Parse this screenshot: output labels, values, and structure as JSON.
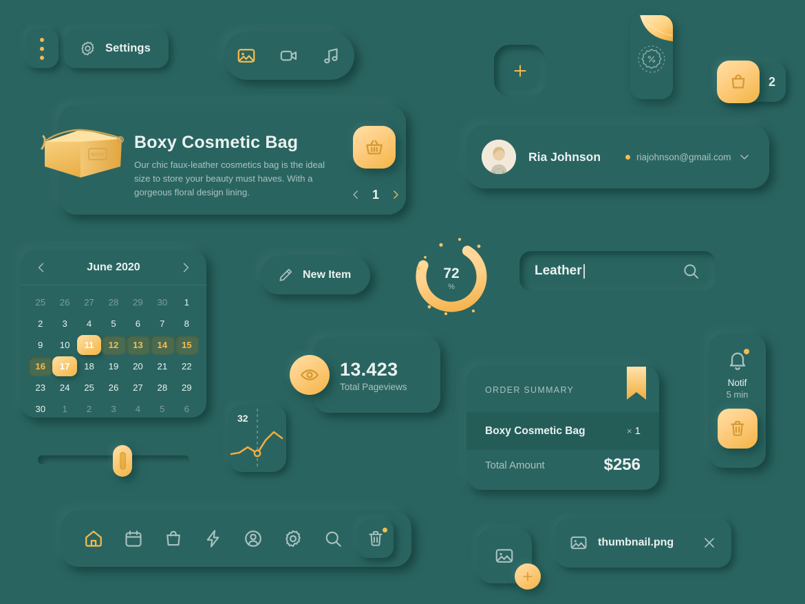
{
  "theme": {
    "background": "#2a6460",
    "accent": "#f5bb4f",
    "accent_light": "#ffdb99",
    "accent_dark": "#d59a33",
    "text": "#eaf2f0",
    "text_dim": "#a9c3bf"
  },
  "topbar": {
    "menu_icon": "three-dots-vertical-icon",
    "settings_label": "Settings",
    "settings_icon": "gear-icon",
    "media_toggle": [
      {
        "icon": "image-icon",
        "active": true
      },
      {
        "icon": "video-camera-icon",
        "active": false
      },
      {
        "icon": "music-note-icon",
        "active": false
      }
    ],
    "add_icon": "plus-icon",
    "coupon_icon": "discount-percent-badge-icon",
    "cart": {
      "icon": "shopping-bag-icon",
      "count": "2"
    }
  },
  "product": {
    "title": "Boxy Cosmetic Bag",
    "description": "Our chic faux-leather cosmetics bag is the ideal size to store your beauty must haves. With a gorgeous floral design lining.",
    "image_icon": "cosmetic-bag-image",
    "basket_icon": "basket-icon",
    "pager": {
      "prev_icon": "chevron-left-icon",
      "page": "1",
      "next_icon": "chevron-right-icon"
    }
  },
  "user": {
    "name": "Ria Johnson",
    "email": "riajohnson@gmail.com",
    "status_dot_color": "#f5bb4f",
    "avatar_icon": "user-avatar",
    "dropdown_icon": "chevron-down-icon"
  },
  "calendar": {
    "title": "June 2020",
    "prev_icon": "chevron-left-icon",
    "next_icon": "chevron-right-icon",
    "days": [
      {
        "n": "25",
        "state": "mute"
      },
      {
        "n": "26",
        "state": "mute"
      },
      {
        "n": "27",
        "state": "mute"
      },
      {
        "n": "28",
        "state": "mute"
      },
      {
        "n": "29",
        "state": "mute"
      },
      {
        "n": "30",
        "state": "mute"
      },
      {
        "n": "1",
        "state": "normal"
      },
      {
        "n": "2",
        "state": "normal"
      },
      {
        "n": "3",
        "state": "normal"
      },
      {
        "n": "4",
        "state": "normal"
      },
      {
        "n": "5",
        "state": "normal"
      },
      {
        "n": "6",
        "state": "normal"
      },
      {
        "n": "7",
        "state": "normal"
      },
      {
        "n": "8",
        "state": "normal"
      },
      {
        "n": "9",
        "state": "normal"
      },
      {
        "n": "10",
        "state": "normal"
      },
      {
        "n": "11",
        "state": "sel"
      },
      {
        "n": "12",
        "state": "range"
      },
      {
        "n": "13",
        "state": "range"
      },
      {
        "n": "14",
        "state": "range"
      },
      {
        "n": "15",
        "state": "range"
      },
      {
        "n": "16",
        "state": "range"
      },
      {
        "n": "17",
        "state": "sel"
      },
      {
        "n": "18",
        "state": "normal"
      },
      {
        "n": "19",
        "state": "normal"
      },
      {
        "n": "20",
        "state": "normal"
      },
      {
        "n": "21",
        "state": "normal"
      },
      {
        "n": "22",
        "state": "normal"
      },
      {
        "n": "23",
        "state": "normal"
      },
      {
        "n": "24",
        "state": "normal"
      },
      {
        "n": "25",
        "state": "normal"
      },
      {
        "n": "26",
        "state": "normal"
      },
      {
        "n": "27",
        "state": "normal"
      },
      {
        "n": "28",
        "state": "normal"
      },
      {
        "n": "29",
        "state": "normal"
      },
      {
        "n": "30",
        "state": "normal"
      },
      {
        "n": "1",
        "state": "mute"
      },
      {
        "n": "2",
        "state": "mute"
      },
      {
        "n": "3",
        "state": "mute"
      },
      {
        "n": "4",
        "state": "mute"
      },
      {
        "n": "5",
        "state": "mute"
      },
      {
        "n": "6",
        "state": "mute"
      }
    ]
  },
  "slider": {
    "value_pct": 57
  },
  "new_item": {
    "label": "New Item",
    "icon": "pencil-icon"
  },
  "progress_ring": {
    "value": "72",
    "unit": "%",
    "pct": 72
  },
  "search": {
    "value": "Leather",
    "placeholder": "Search",
    "icon": "search-icon"
  },
  "pageviews": {
    "value": "13.423",
    "label": "Total Pageviews",
    "icon": "eye-icon"
  },
  "sparkline": {
    "value": "32"
  },
  "order": {
    "heading": "ORDER SUMMARY",
    "item": "Boxy Cosmetic Bag",
    "qty_symbol": "×",
    "qty": "1",
    "total_label": "Total Amount",
    "total_value": "$256",
    "bookmark_icon": "bookmark-icon"
  },
  "notif": {
    "title": "Notif",
    "time": "5 min",
    "bell_icon": "bell-icon",
    "delete_icon": "trash-icon"
  },
  "nav": [
    {
      "icon": "home-icon",
      "name": "home",
      "active": true
    },
    {
      "icon": "calendar-icon",
      "name": "calendar",
      "active": false
    },
    {
      "icon": "shopping-bag-icon",
      "name": "shop",
      "active": false
    },
    {
      "icon": "lightning-bolt-icon",
      "name": "activity",
      "active": false
    },
    {
      "icon": "user-circle-icon",
      "name": "profile",
      "active": false
    },
    {
      "icon": "gear-icon",
      "name": "settings",
      "active": false
    },
    {
      "icon": "search-icon",
      "name": "search",
      "active": false
    },
    {
      "icon": "trash-icon",
      "name": "trash",
      "active": false
    }
  ],
  "upload": {
    "tile_icon": "image-icon",
    "fab_icon": "plus-icon",
    "file_icon": "image-icon",
    "file_name": "thumbnail.png",
    "remove_icon": "close-icon"
  },
  "chart_data": {
    "type": "line",
    "title": "",
    "label": "32",
    "x": [
      0,
      1,
      2,
      3,
      4,
      5,
      6,
      7
    ],
    "values": [
      22,
      20,
      26,
      33,
      27,
      44,
      56,
      48
    ],
    "marker_index": 4,
    "marker_value": 27,
    "grid": false
  }
}
